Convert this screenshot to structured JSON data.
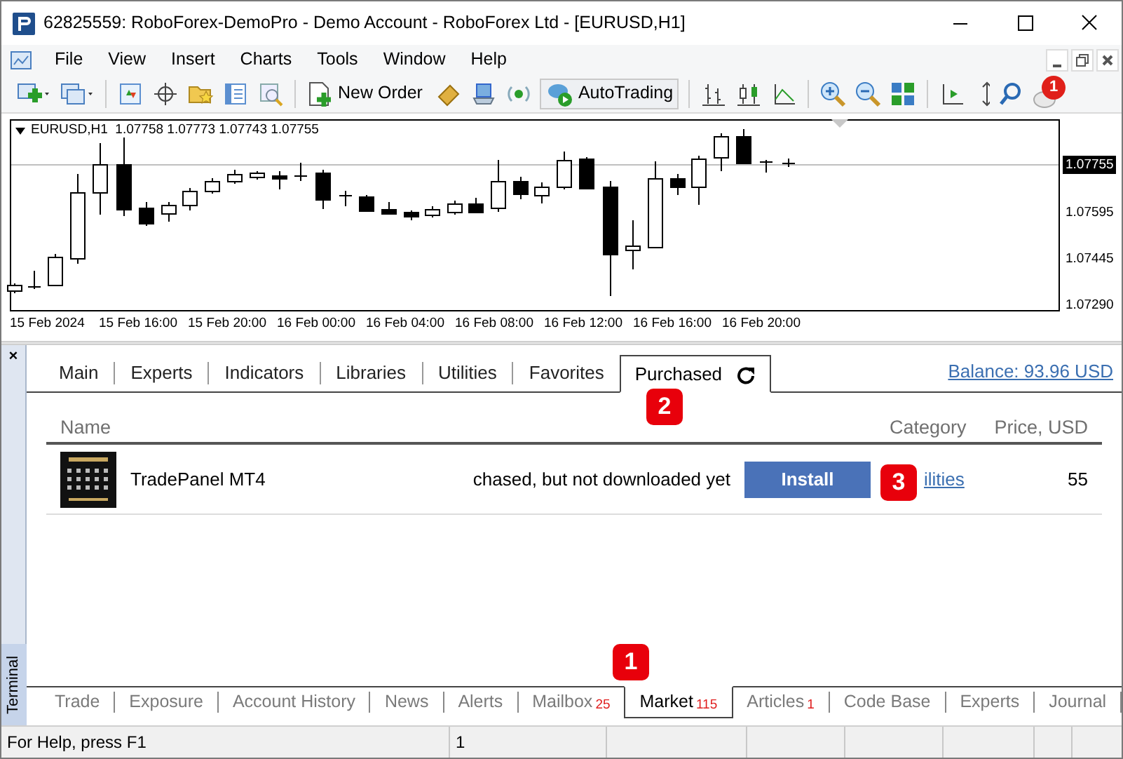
{
  "window": {
    "title": "62825559: RoboForex-DemoPro - Demo Account - RoboForex Ltd - [EURUSD,H1]"
  },
  "menu": [
    "File",
    "View",
    "Insert",
    "Charts",
    "Tools",
    "Window",
    "Help"
  ],
  "toolbar": {
    "new_order": "New Order",
    "autotrading": "AutoTrading",
    "notification_count": "1"
  },
  "chart": {
    "header": "EURUSD,H1  1.07758 1.07773 1.07743 1.07755",
    "price_labels": [
      {
        "text": "1.07755",
        "kind": "current"
      },
      {
        "text": "1.07595",
        "kind": "tick"
      },
      {
        "text": "1.07445",
        "kind": "tick"
      },
      {
        "text": "1.07290",
        "kind": "tick"
      }
    ],
    "time_labels": [
      "15 Feb 2024",
      "15 Feb 16:00",
      "15 Feb 20:00",
      "16 Feb 00:00",
      "16 Feb 04:00",
      "16 Feb 08:00",
      "16 Feb 12:00",
      "16 Feb 16:00",
      "16 Feb 20:00"
    ]
  },
  "terminal": {
    "close": "×",
    "label": "Terminal",
    "market_tabs": [
      {
        "label": "Main",
        "selected": false
      },
      {
        "label": "Experts",
        "selected": false
      },
      {
        "label": "Indicators",
        "selected": false
      },
      {
        "label": "Libraries",
        "selected": false
      },
      {
        "label": "Utilities",
        "selected": false
      },
      {
        "label": "Favorites",
        "selected": false
      },
      {
        "label": "Purchased",
        "selected": true
      }
    ],
    "balance": "Balance: 93.96 USD",
    "columns": [
      "Name",
      "Category",
      "Price, USD"
    ],
    "rows": [
      {
        "name": "TradePanel MT4",
        "status": "chased, but not downloaded yet",
        "action": "Install",
        "category": "ilities",
        "price": "55"
      }
    ],
    "bottom_tabs": [
      {
        "label": "Trade",
        "selected": false
      },
      {
        "label": "Exposure",
        "selected": false
      },
      {
        "label": "Account History",
        "selected": false
      },
      {
        "label": "News",
        "selected": false
      },
      {
        "label": "Alerts",
        "selected": false
      },
      {
        "label": "Mailbox",
        "count": "25",
        "selected": false
      },
      {
        "label": "Market",
        "count": "115",
        "selected": true
      },
      {
        "label": "Articles",
        "count": "1",
        "selected": false
      },
      {
        "label": "Code Base",
        "selected": false
      },
      {
        "label": "Experts",
        "selected": false
      },
      {
        "label": "Journal",
        "selected": false
      }
    ]
  },
  "status_bar": [
    "For Help, press F1",
    "1"
  ],
  "markers": [
    "1",
    "2",
    "3"
  ]
}
